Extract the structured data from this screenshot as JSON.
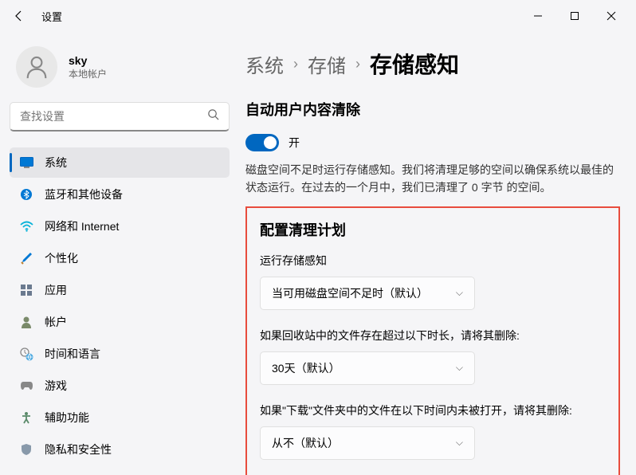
{
  "titlebar": {
    "title": "设置"
  },
  "user": {
    "name": "sky",
    "type": "本地帐户"
  },
  "search": {
    "placeholder": "查找设置"
  },
  "nav": {
    "items": [
      {
        "label": "系统"
      },
      {
        "label": "蓝牙和其他设备"
      },
      {
        "label": "网络和 Internet"
      },
      {
        "label": "个性化"
      },
      {
        "label": "应用"
      },
      {
        "label": "帐户"
      },
      {
        "label": "时间和语言"
      },
      {
        "label": "游戏"
      },
      {
        "label": "辅助功能"
      },
      {
        "label": "隐私和安全性"
      }
    ]
  },
  "breadcrumb": {
    "system": "系统",
    "storage": "存储",
    "current": "存储感知"
  },
  "mainContent": {
    "sectionHeading": "自动用户内容清除",
    "toggleLabel": "开",
    "description": "磁盘空间不足时运行存储感知。我们将清理足够的空间以确保系统以最佳的状态运行。在过去的一个月中，我们已清理了 0 字节 的空间。"
  },
  "config": {
    "heading": "配置清理计划",
    "field1Label": "运行存储感知",
    "field1Value": "当可用磁盘空间不足时（默认）",
    "field2Label": "如果回收站中的文件存在超过以下时长，请将其删除:",
    "field2Value": "30天（默认）",
    "field3Label": "如果\"下载\"文件夹中的文件在以下时间内未被打开，请将其删除:",
    "field3Value": "从不（默认）"
  }
}
